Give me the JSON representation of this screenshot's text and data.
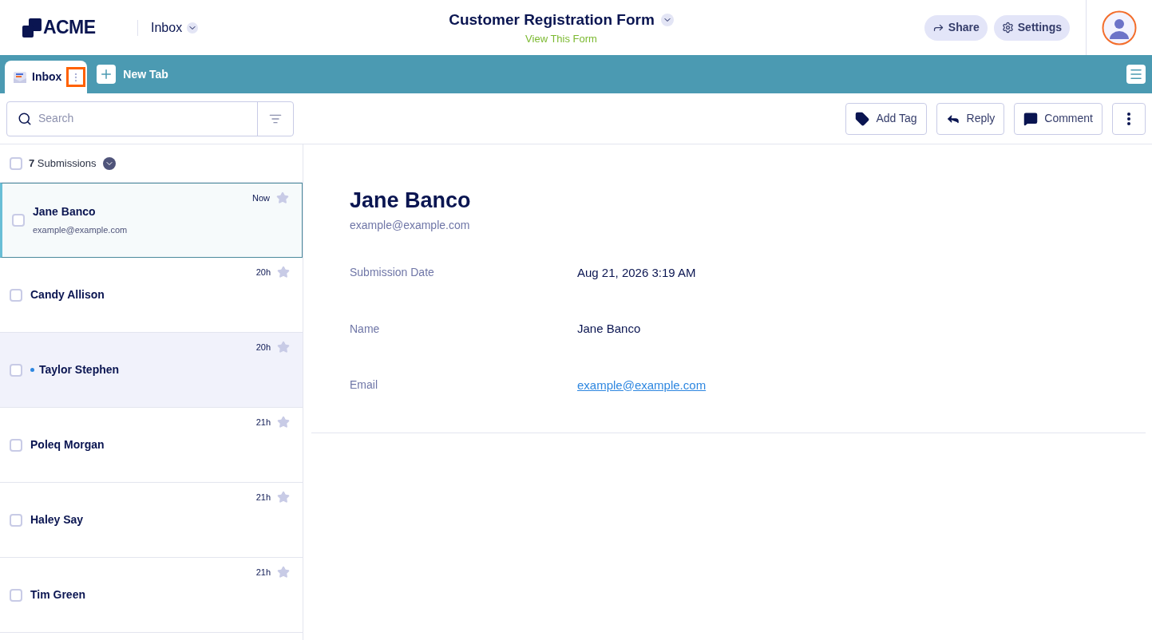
{
  "header": {
    "logo": "ACME",
    "section": "Inbox",
    "form_title": "Customer Registration Form",
    "form_link": "View This Form",
    "buttons": [
      {
        "kind": "share",
        "label": "Share"
      },
      {
        "kind": "settings",
        "label": "Settings"
      }
    ]
  },
  "tabs": [
    {
      "label": "Inbox",
      "selected": true
    },
    {
      "label": "New Tab",
      "kind": "new"
    }
  ],
  "search": {
    "placeholder": "Search"
  },
  "actions": [
    {
      "kind": "tag",
      "label": "Add Tag"
    },
    {
      "kind": "reply",
      "label": "Reply"
    },
    {
      "kind": "comment",
      "label": "Comment"
    }
  ],
  "list": {
    "count": "7",
    "count_label": "Submissions",
    "checked": false,
    "items": [
      {
        "name": "Jane Banco",
        "email": "example@example.com",
        "time": "Now",
        "selected": true,
        "unread": false,
        "checked": false,
        "starred": false
      },
      {
        "name": "Candy Allison",
        "time": "20h",
        "selected": false,
        "unread": false,
        "checked": false,
        "starred": false
      },
      {
        "name": "Taylor Stephen",
        "time": "20h",
        "selected": false,
        "unread": true,
        "checked": false,
        "starred": false
      },
      {
        "name": "Poleq Morgan",
        "time": "21h",
        "selected": false,
        "unread": false,
        "checked": false,
        "starred": false
      },
      {
        "name": "Haley Say",
        "time": "21h",
        "selected": false,
        "unread": false,
        "checked": false,
        "starred": false
      },
      {
        "name": "Tim Green",
        "time": "21h",
        "selected": false,
        "unread": false,
        "checked": false,
        "starred": false
      }
    ]
  },
  "detail": {
    "name": "Jane Banco",
    "email": "example@example.com",
    "fields": [
      {
        "label": "Submission Date",
        "value": "Aug 21, 2026 3:19 AM",
        "kind": "text"
      },
      {
        "label": "Name",
        "value": "Jane Banco",
        "kind": "text"
      },
      {
        "label": "Email",
        "value": "example@example.com",
        "kind": "link"
      }
    ]
  }
}
